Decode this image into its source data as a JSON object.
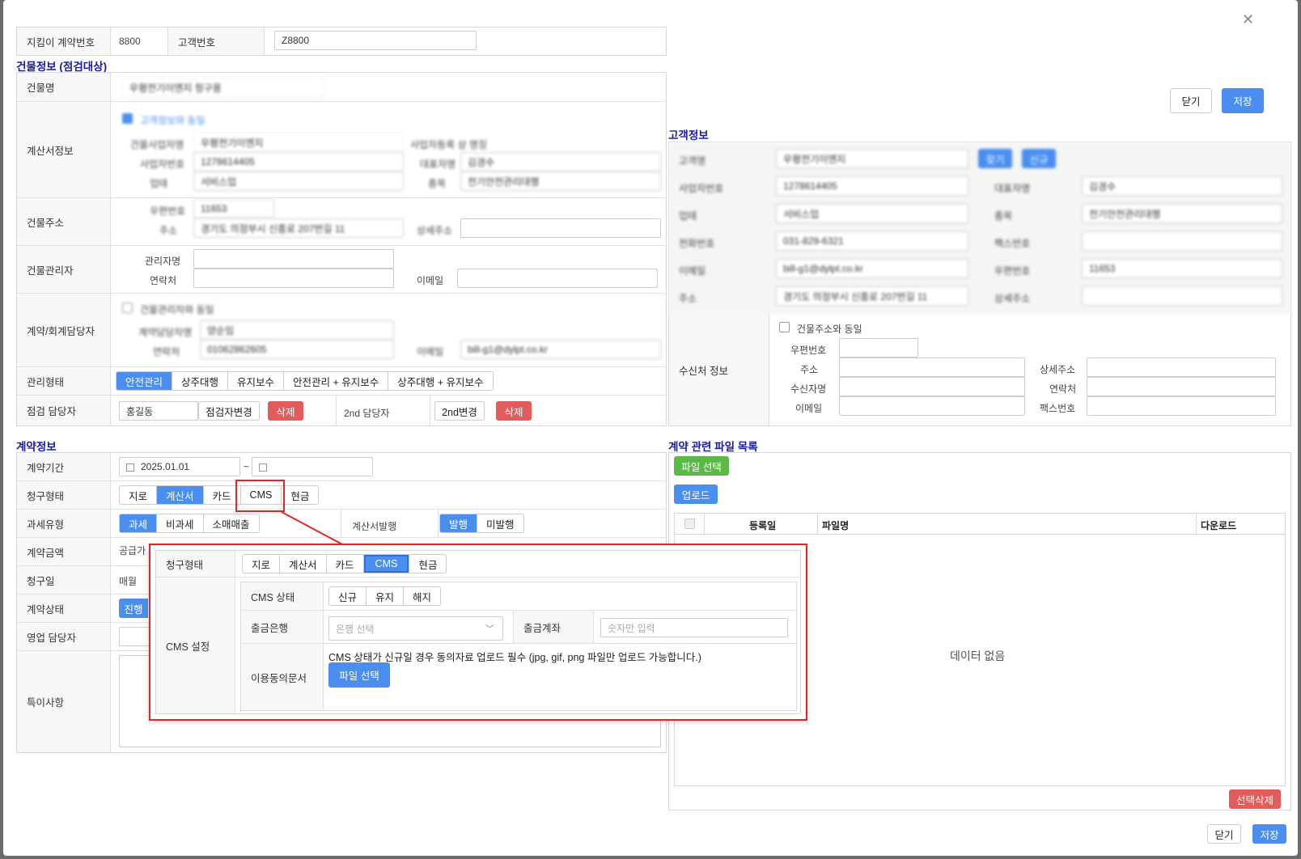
{
  "top": {
    "contract_label": "지킴이 계약번호",
    "contract_value": "8800",
    "customer_no_label": "고객번호",
    "customer_no_value": "Z8800"
  },
  "building_section": {
    "title": "건물정보 (점검대상)",
    "name_label": "건물명",
    "name_value": "우평전기이엔지 청구용",
    "invoice_label": "계산서정보",
    "same_as_customer": "고객정보와 동일",
    "biz_name_label": "건물사업자명",
    "biz_name_value": "우평전기이엔지",
    "biz_no_same_label": "사업자등록 상 명칭",
    "biz_no_label": "사업자번호",
    "biz_no_value": "1278614405",
    "rep_label": "대표자명",
    "rep_value": "김경수",
    "type_label": "업태",
    "type_value": "서비스업",
    "item_label": "종목",
    "item_value": "전기안전관리대행",
    "address_label": "건물주소",
    "zip_label": "우편번호",
    "zip_value": "11653",
    "addr_label": "주소",
    "addr_value": "경기도 의정부시 신흥로 207번길 11",
    "addr_detail_label": "상세주소",
    "manager_label": "건물관리자",
    "manager_name_label": "관리자명",
    "manager_phone_label": "연락처",
    "manager_email_label": "이메일",
    "contact_label": "계약/회계담당자",
    "same_as_manager": "건물관리자와 동일",
    "contact_name_label": "계약담당자명",
    "contact_name_value": "양순임",
    "contact_phone_label": "연락처",
    "contact_phone_value": "01062862605",
    "contact_email_label": "이메일",
    "contact_email_value": "bill-g1@dylpt.co.kr",
    "mgmt_label": "관리형태",
    "mgmt_options": [
      "안전관리",
      "상주대행",
      "유지보수",
      "안전관리 + 유지보수",
      "상주대행 + 유지보수"
    ],
    "inspector_label": "점검 담당자",
    "inspector_value": "홍길동",
    "inspector_change": "점검자변경",
    "delete": "삭제",
    "second_label": "2nd 담당자",
    "second_change": "2nd변경"
  },
  "customer_section": {
    "title": "고객정보",
    "close": "닫기",
    "save": "저장",
    "name_label": "고객명",
    "name_value": "우평전기이엔지",
    "search_btn": "찾기",
    "new_btn": "신규",
    "biz_no_label": "사업자번호",
    "biz_no_value": "1278614405",
    "rep_label": "대표자명",
    "rep_value": "김경수",
    "type_label": "업태",
    "type_value": "서비스업",
    "item_label": "종목",
    "item_value": "전기안전관리대행",
    "phone_label": "전화번호",
    "phone_value": "031-829-6321",
    "fax_label": "팩스번호",
    "email_label": "이메일",
    "email_value": "bill-g1@dylpt.co.kr",
    "zip_label": "우편번호",
    "zip_value": "11653",
    "addr_label": "주소",
    "addr_value": "경기도 의정부시 신흥로 207번길 11",
    "addr_detail_label": "상세주소",
    "recv_label": "수신처 정보",
    "same_as_building": "건물주소와 동일",
    "recv_zip": "우편번호",
    "recv_addr": "주소",
    "recv_addr_detail": "상세주소",
    "recv_name": "수신자명",
    "recv_phone": "연락처",
    "recv_email": "이메일",
    "recv_fax": "팩스번호"
  },
  "contract_section": {
    "title": "계약정보",
    "period_label": "계약기간",
    "period_start": "2025.01.01",
    "tilde": "~",
    "billing_label": "청구형태",
    "billing_options": [
      "지로",
      "계산서",
      "카드",
      "CMS",
      "현금"
    ],
    "tax_label": "과세유형",
    "tax_options": [
      "과세",
      "비과세",
      "소매매출"
    ],
    "invoice_issue_label": "계산서발행",
    "invoice_issue_options": [
      "발행",
      "미발행"
    ],
    "amount_label": "계약금액",
    "supply_label": "공급가",
    "billing_day_label": "청구일",
    "monthly": "매월",
    "status_label": "계약상태",
    "status_btn": "진행",
    "sales_label": "영업 담당자",
    "notes_label": "특이사항"
  },
  "files_section": {
    "title": "계약 관련 파일 목록",
    "select_btn": "파일 선택",
    "upload_btn": "업로드",
    "col_date": "등록일",
    "col_name": "파일명",
    "col_download": "다운로드",
    "empty": "데이터 없음",
    "delete_selected": "선택삭제"
  },
  "callout": {
    "billing_label": "청구형태",
    "billing_options": [
      "지로",
      "계산서",
      "카드",
      "CMS",
      "현금"
    ],
    "cms_setting_label": "CMS 설정",
    "cms_status_label": "CMS 상태",
    "cms_status_options": [
      "신규",
      "유지",
      "해지"
    ],
    "bank_label": "출금은행",
    "bank_placeholder": "은행 선택",
    "account_label": "출금계좌",
    "account_placeholder": "숫자만 입력",
    "consent_label": "이용동의문서",
    "consent_note": "CMS 상태가 신규일 경우 동의자료 업로드 필수 (jpg, gif, png 파일만 업로드 가능합니다.)",
    "file_btn": "파일 선택"
  },
  "footer": {
    "close": "닫기",
    "save": "저장"
  }
}
